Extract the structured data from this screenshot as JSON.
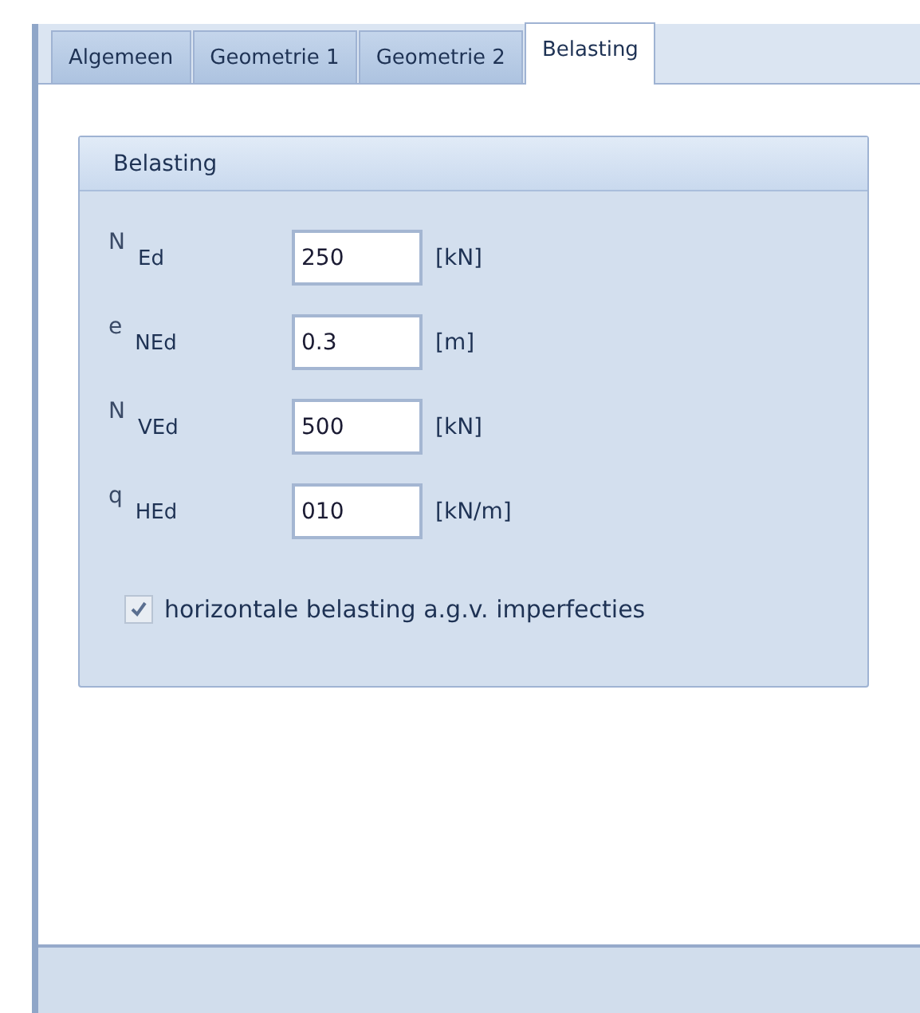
{
  "tabs": [
    {
      "label": "Algemeen",
      "selected": false
    },
    {
      "label": "Geometrie 1",
      "selected": false
    },
    {
      "label": "Geometrie 2",
      "selected": false
    },
    {
      "label": "Belasting",
      "selected": true
    }
  ],
  "group": {
    "title": "Belasting",
    "fields": [
      {
        "symbol": "N",
        "subscript": "Ed",
        "value": "250",
        "unit": "[kN]"
      },
      {
        "symbol": "e",
        "subscript": "NEd",
        "value": "0.3",
        "unit": "[m]"
      },
      {
        "symbol": "N",
        "subscript": "VEd",
        "value": "500",
        "unit": "[kN]"
      },
      {
        "symbol": "q",
        "subscript": "HEd",
        "value": "010",
        "unit": "[kN/m]"
      }
    ],
    "checkbox": {
      "label": "horizontale belasting a.g.v. imperfecties",
      "checked": true
    }
  }
}
